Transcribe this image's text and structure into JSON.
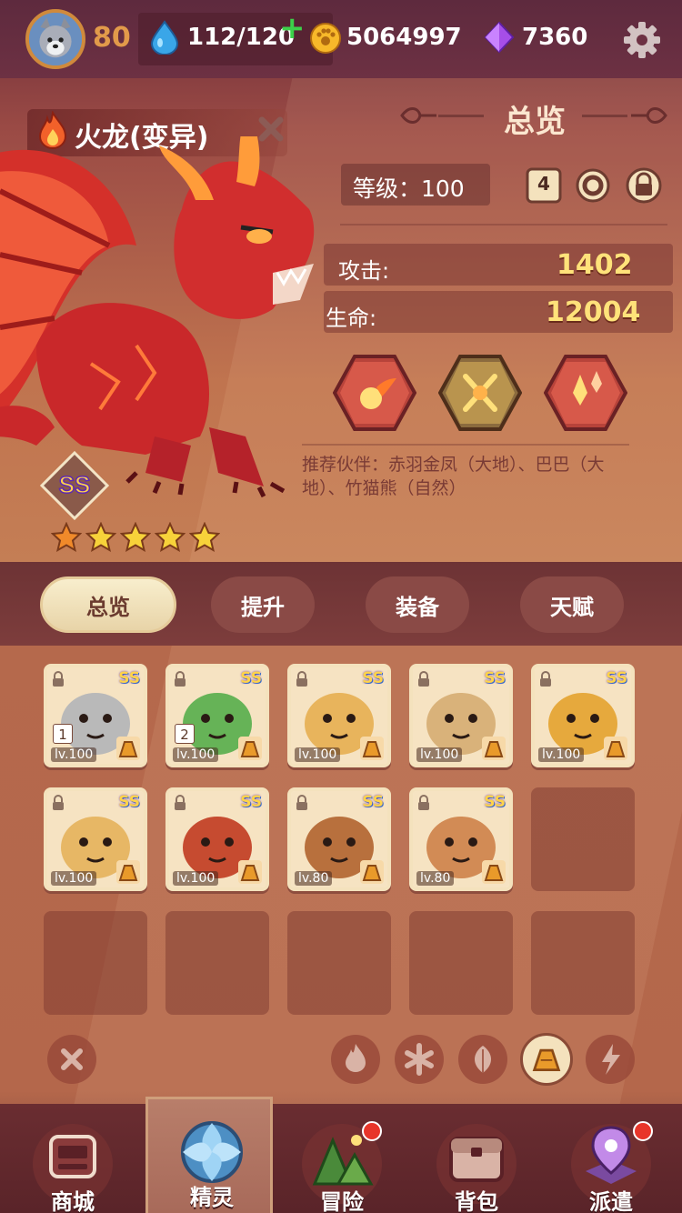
{
  "topbar": {
    "player_level": "80",
    "energy": "112/120",
    "energy_plus": "+",
    "coins": "5064997",
    "gems": "7360"
  },
  "pet": {
    "name": "火龙(变异)",
    "rank": "SS",
    "stars": 5
  },
  "overview": {
    "title": "总览",
    "level_label": "等级：100",
    "mini_badge": "4",
    "stats": [
      {
        "label": "攻击:",
        "value": "1402"
      },
      {
        "label": "生命:",
        "value": "12004"
      }
    ],
    "recommend": "推荐伙伴：赤羽金凤（大地）、巴巴（大地）、竹猫熊（自然）"
  },
  "tabs": [
    {
      "label": "总览",
      "active": true
    },
    {
      "label": "提升",
      "active": false
    },
    {
      "label": "装备",
      "active": false
    },
    {
      "label": "天赋",
      "active": false
    }
  ],
  "roster": [
    {
      "level": "lv.100",
      "rank": "SS",
      "slot": "1",
      "theme": "#b9b9b9"
    },
    {
      "level": "lv.100",
      "rank": "SS",
      "slot": "2",
      "theme": "#66b357"
    },
    {
      "level": "lv.100",
      "rank": "SS",
      "slot": "",
      "theme": "#e8b45c"
    },
    {
      "level": "lv.100",
      "rank": "SS",
      "slot": "",
      "theme": "#d9b27a"
    },
    {
      "level": "lv.100",
      "rank": "SS",
      "slot": "",
      "theme": "#e6a93d"
    },
    {
      "level": "lv.100",
      "rank": "SS",
      "slot": "",
      "theme": "#e7b765"
    },
    {
      "level": "lv.100",
      "rank": "SS",
      "slot": "",
      "theme": "#c64b30"
    },
    {
      "level": "lv.80",
      "rank": "SS",
      "slot": "",
      "theme": "#b8703d"
    },
    {
      "level": "lv.80",
      "rank": "SS",
      "slot": "",
      "theme": "#d28b55"
    }
  ],
  "filters": [
    "clear",
    "fire",
    "water",
    "nature",
    "earth",
    "thunder"
  ],
  "nav": [
    {
      "label": "商城",
      "icon": "shop-icon",
      "badge": false
    },
    {
      "label": "精灵",
      "icon": "spirit-icon",
      "badge": false,
      "active": true
    },
    {
      "label": "冒险",
      "icon": "adventure-icon",
      "badge": true
    },
    {
      "label": "背包",
      "icon": "backpack-icon",
      "badge": false
    },
    {
      "label": "派遣",
      "icon": "dispatch-icon",
      "badge": true
    }
  ],
  "colors": {
    "accent_gold": "#ffe27a",
    "tab_active": "#f4e2bd",
    "badge_red": "#e8352a"
  }
}
